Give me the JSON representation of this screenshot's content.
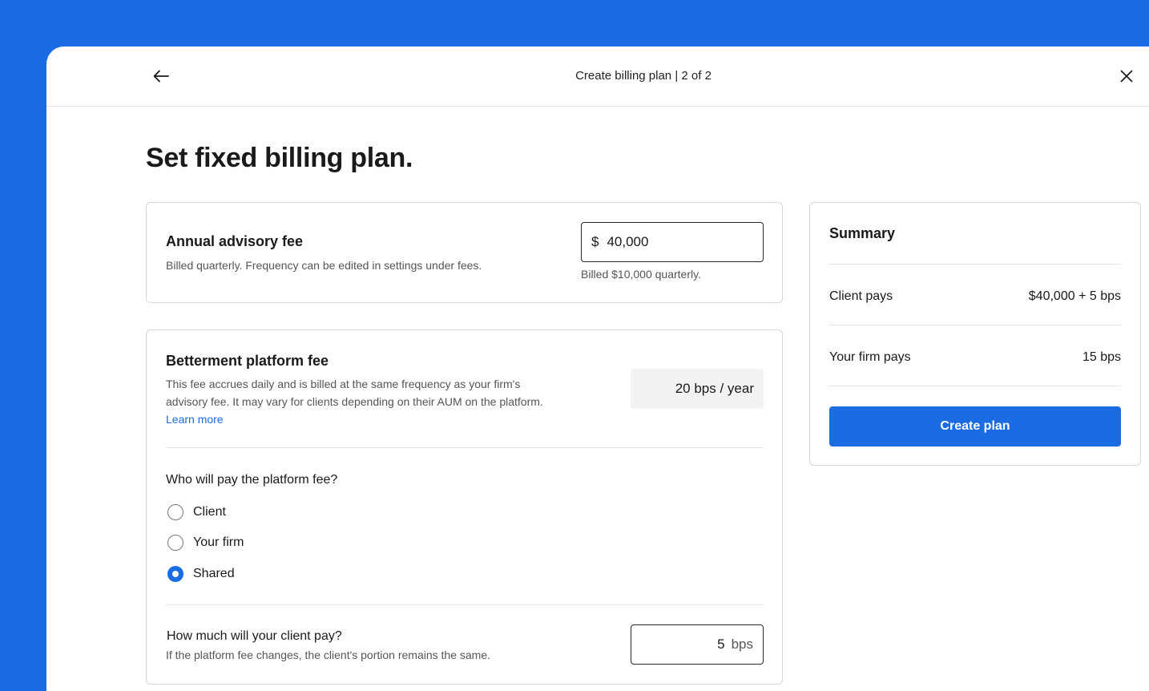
{
  "header": {
    "title": "Create billing plan | 2 of 2",
    "back_icon": "arrow-left-icon",
    "close_icon": "close-icon"
  },
  "page": {
    "title": "Set fixed billing plan."
  },
  "advisory_fee": {
    "heading": "Annual advisory fee",
    "description": "Billed quarterly. Frequency can be edited in settings under fees.",
    "currency_symbol": "$",
    "value": "40,000",
    "helper": "Billed $10,000 quarterly."
  },
  "platform_fee": {
    "heading": "Betterment platform fee",
    "description_line1": "This fee accrues daily and is billed at the same frequency as your firm's",
    "description_line2": "advisory fee. It may vary for clients depending on their AUM on the platform.",
    "learn_more": "Learn more",
    "rate": "20 bps / year",
    "question": "Who will pay the platform fee?",
    "options": [
      {
        "label": "Client",
        "selected": false
      },
      {
        "label": "Your firm",
        "selected": false
      },
      {
        "label": "Shared",
        "selected": true
      }
    ],
    "client_pay_question": "How much will your client pay?",
    "client_pay_description": "If the platform fee changes, the client's portion remains the same.",
    "client_pay_value": "5",
    "client_pay_unit": "bps"
  },
  "summary": {
    "title": "Summary",
    "rows": [
      {
        "label": "Client pays",
        "value": "$40,000 + 5 bps"
      },
      {
        "label": "Your firm pays",
        "value": "15 bps"
      }
    ],
    "button_label": "Create plan"
  },
  "colors": {
    "accent": "#1B6BE2",
    "border": "#d6d6d6",
    "divider": "#e3e3e3",
    "readonly_bg": "#f3f3f3"
  }
}
